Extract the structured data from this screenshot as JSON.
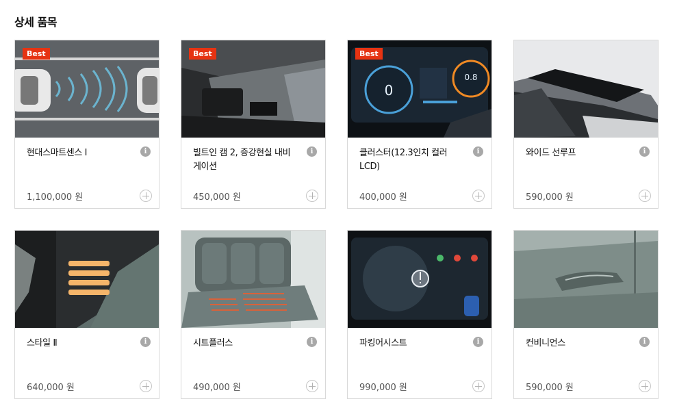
{
  "section_title": "상세 품목",
  "badge_label": "Best",
  "colors": {
    "badge": "#e63312",
    "border": "#d9d9d9"
  },
  "items": [
    {
      "name": "현대스마트센스 Ⅰ",
      "price": "1,100,000 원",
      "best": true
    },
    {
      "name": "빌트인 캠 2, 증강현실 내비게이션",
      "price": "450,000 원",
      "best": true
    },
    {
      "name": "클러스터(12.3인치 컬러 LCD)",
      "price": "400,000 원",
      "best": true
    },
    {
      "name": "와이드 선루프",
      "price": "590,000 원",
      "best": false
    },
    {
      "name": "스타일 Ⅱ",
      "price": "640,000 원",
      "best": false
    },
    {
      "name": "시트플러스",
      "price": "490,000 원",
      "best": false
    },
    {
      "name": "파킹어시스트",
      "price": "990,000 원",
      "best": false
    },
    {
      "name": "컨비니언스",
      "price": "590,000 원",
      "best": false
    }
  ],
  "images": {
    "cluster_left_value": "0",
    "cluster_right_value": "0.8"
  }
}
